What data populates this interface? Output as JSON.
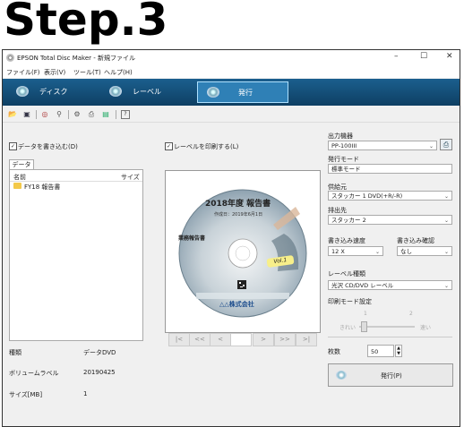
{
  "step_title": "Step.3",
  "window": {
    "title": "EPSON Total Disc Maker - 新規ファイル",
    "controls": [
      "–",
      "☐",
      "✕"
    ]
  },
  "menu": [
    "ファイル(F)",
    "表示(V)",
    "ツール(T)",
    "ヘルプ(H)"
  ],
  "modes": [
    {
      "label": "ディスク",
      "active": false
    },
    {
      "label": "レーベル",
      "active": false
    },
    {
      "label": "発行",
      "active": true
    }
  ],
  "toolbar_icons": [
    "open-folder-icon",
    "save-icon",
    "disc-icon",
    "tools-icon",
    "settings-icon",
    "printer-icon",
    "export-icon",
    "help-icon"
  ],
  "left": {
    "write_data_checkbox": "データを書き込む(D)",
    "tab": "データ",
    "col_name": "名前",
    "col_size": "サイズ",
    "items": [
      "FY18 報告書"
    ],
    "info": [
      {
        "label": "種類",
        "value": "データDVD"
      },
      {
        "label": "ボリュームラベル",
        "value": "20190425"
      },
      {
        "label": "サイズ[MB]",
        "value": "1"
      }
    ]
  },
  "center": {
    "print_label_checkbox": "レーベルを印刷する(L)",
    "disc": {
      "title": "2018年度 報告書",
      "created": "作成日：2019年6月1日",
      "caption": "業務報告書",
      "badge": "Vol.1",
      "company": "△△株式会社"
    },
    "nav": [
      "|<",
      "<<",
      "<",
      "",
      ">",
      ">>",
      ">|"
    ]
  },
  "right": {
    "output_device_label": "出力機器",
    "output_device": "PP-100III",
    "issue_mode_label": "発行モード",
    "issue_mode": "標準モード",
    "supply_label": "供給元",
    "supply": "スタッカー 1 DVD(+R/-R)",
    "eject_label": "排出先",
    "eject": "スタッカー 2",
    "write_speed_label": "書き込み速度",
    "write_speed": "12 X",
    "verify_label": "書き込み確認",
    "verify": "なし",
    "label_type_label": "レーベル種類",
    "label_type": "光沢 CD/DVD レーベル",
    "print_mode_label": "印刷モード設定",
    "print_mode_ticks": [
      "1",
      "2"
    ],
    "print_mode_ends": [
      "きれい",
      "速い"
    ],
    "copies_label": "枚数",
    "copies": "50",
    "issue_button": "発行(P)"
  }
}
